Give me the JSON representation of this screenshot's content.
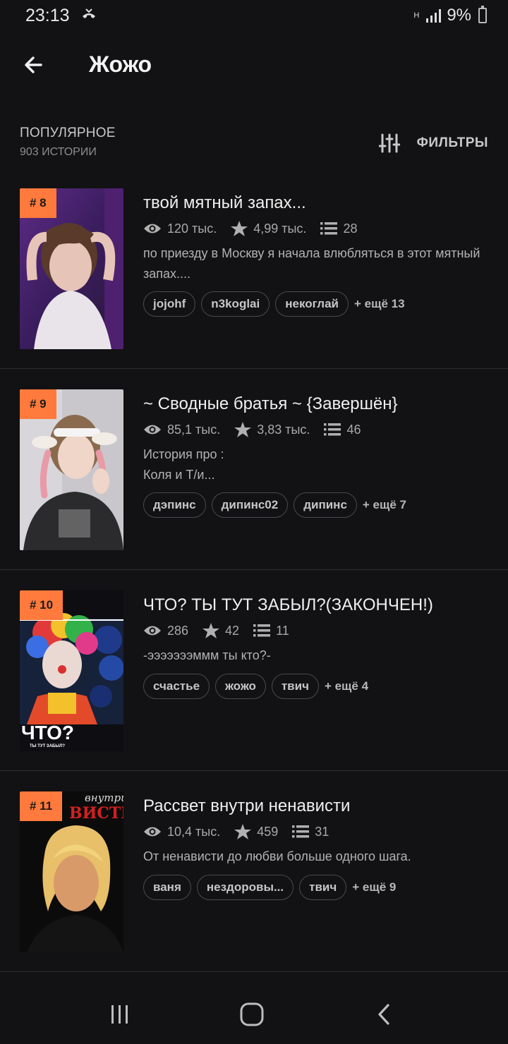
{
  "status_bar": {
    "time": "23:13",
    "network": "H",
    "battery": "9%"
  },
  "header": {
    "back_icon": "arrow-left-icon",
    "title": "Жожо"
  },
  "subheader": {
    "sort_label": "ПОПУЛЯРНОЕ",
    "story_count": "903 ИСТОРИИ",
    "filters_icon": "sliders-icon",
    "filters_label": "ФИЛЬТРЫ"
  },
  "colors": {
    "background": "#121113",
    "rank_badge": "#ff7a3c",
    "tag_border": "#4a4a4e"
  },
  "stories": [
    {
      "rank": "# 8",
      "title": "твой мятный запах...",
      "reads": "120 тыс.",
      "votes": "4,99 тыс.",
      "parts": "28",
      "description": "по приезду в Москву я начала влюбляться в этот мятный запах....",
      "tags": [
        "jojohf",
        "n3koglai",
        "некоглай"
      ],
      "more": "+ ещё 13"
    },
    {
      "rank": "# 9",
      "title": "~ Сводные братья ~ {Завершён}",
      "reads": "85,1 тыс.",
      "votes": "3,83 тыс.",
      "parts": "46",
      "description": "История про :\nКоля и Т/и...",
      "tags": [
        "дэпинс",
        "дипинс02",
        "дипинс"
      ],
      "more": "+ ещё 7"
    },
    {
      "rank": "# 10",
      "title": "ЧТО? ТЫ ТУТ ЗАБЫЛ?(ЗАКОНЧЕН!)",
      "reads": "286",
      "votes": "42",
      "parts": "11",
      "description": "-эээээээммм ты кто?-",
      "tags": [
        "счастье",
        "жожо",
        "твич"
      ],
      "more": "+ ещё 4",
      "cover_text": "ЧТО?",
      "cover_subtext": "ТЫ ТУТ ЗАБЫЛ?"
    },
    {
      "rank": "# 11",
      "title": "Рассвет внутри ненависти",
      "reads": "10,4 тыс.",
      "votes": "459",
      "parts": "31",
      "description": "От ненависти до любви больше одного шага.",
      "tags": [
        "ваня",
        "нездоровы...",
        "твич"
      ],
      "more": "+ ещё 9",
      "cover_text": "ВИСТИ",
      "cover_script": "внутри"
    }
  ],
  "nav_bar": {
    "recents_icon": "recents-icon",
    "home_icon": "home-icon",
    "back_icon": "nav-back-icon"
  }
}
